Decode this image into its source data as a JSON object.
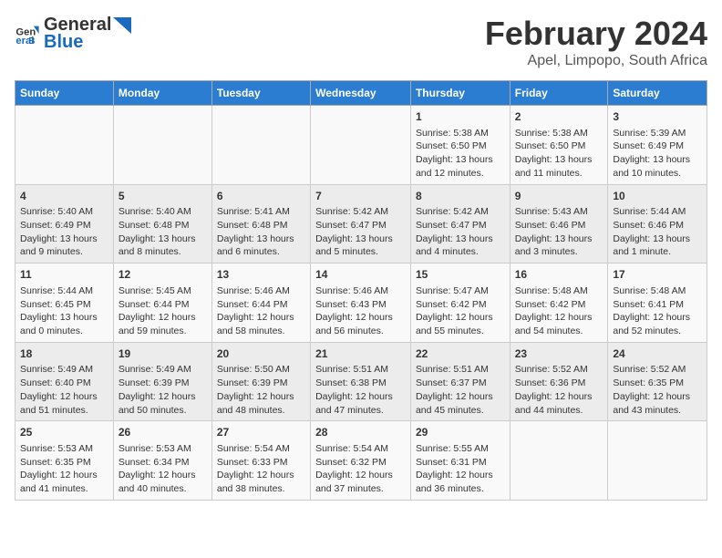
{
  "logo": {
    "line1": "General",
    "line2": "Blue"
  },
  "title": "February 2024",
  "subtitle": "Apel, Limpopo, South Africa",
  "days_of_week": [
    "Sunday",
    "Monday",
    "Tuesday",
    "Wednesday",
    "Thursday",
    "Friday",
    "Saturday"
  ],
  "weeks": [
    [
      {
        "day": "",
        "info": ""
      },
      {
        "day": "",
        "info": ""
      },
      {
        "day": "",
        "info": ""
      },
      {
        "day": "",
        "info": ""
      },
      {
        "day": "1",
        "info": "Sunrise: 5:38 AM\nSunset: 6:50 PM\nDaylight: 13 hours and 12 minutes."
      },
      {
        "day": "2",
        "info": "Sunrise: 5:38 AM\nSunset: 6:50 PM\nDaylight: 13 hours and 11 minutes."
      },
      {
        "day": "3",
        "info": "Sunrise: 5:39 AM\nSunset: 6:49 PM\nDaylight: 13 hours and 10 minutes."
      }
    ],
    [
      {
        "day": "4",
        "info": "Sunrise: 5:40 AM\nSunset: 6:49 PM\nDaylight: 13 hours and 9 minutes."
      },
      {
        "day": "5",
        "info": "Sunrise: 5:40 AM\nSunset: 6:48 PM\nDaylight: 13 hours and 8 minutes."
      },
      {
        "day": "6",
        "info": "Sunrise: 5:41 AM\nSunset: 6:48 PM\nDaylight: 13 hours and 6 minutes."
      },
      {
        "day": "7",
        "info": "Sunrise: 5:42 AM\nSunset: 6:47 PM\nDaylight: 13 hours and 5 minutes."
      },
      {
        "day": "8",
        "info": "Sunrise: 5:42 AM\nSunset: 6:47 PM\nDaylight: 13 hours and 4 minutes."
      },
      {
        "day": "9",
        "info": "Sunrise: 5:43 AM\nSunset: 6:46 PM\nDaylight: 13 hours and 3 minutes."
      },
      {
        "day": "10",
        "info": "Sunrise: 5:44 AM\nSunset: 6:46 PM\nDaylight: 13 hours and 1 minute."
      }
    ],
    [
      {
        "day": "11",
        "info": "Sunrise: 5:44 AM\nSunset: 6:45 PM\nDaylight: 13 hours and 0 minutes."
      },
      {
        "day": "12",
        "info": "Sunrise: 5:45 AM\nSunset: 6:44 PM\nDaylight: 12 hours and 59 minutes."
      },
      {
        "day": "13",
        "info": "Sunrise: 5:46 AM\nSunset: 6:44 PM\nDaylight: 12 hours and 58 minutes."
      },
      {
        "day": "14",
        "info": "Sunrise: 5:46 AM\nSunset: 6:43 PM\nDaylight: 12 hours and 56 minutes."
      },
      {
        "day": "15",
        "info": "Sunrise: 5:47 AM\nSunset: 6:42 PM\nDaylight: 12 hours and 55 minutes."
      },
      {
        "day": "16",
        "info": "Sunrise: 5:48 AM\nSunset: 6:42 PM\nDaylight: 12 hours and 54 minutes."
      },
      {
        "day": "17",
        "info": "Sunrise: 5:48 AM\nSunset: 6:41 PM\nDaylight: 12 hours and 52 minutes."
      }
    ],
    [
      {
        "day": "18",
        "info": "Sunrise: 5:49 AM\nSunset: 6:40 PM\nDaylight: 12 hours and 51 minutes."
      },
      {
        "day": "19",
        "info": "Sunrise: 5:49 AM\nSunset: 6:39 PM\nDaylight: 12 hours and 50 minutes."
      },
      {
        "day": "20",
        "info": "Sunrise: 5:50 AM\nSunset: 6:39 PM\nDaylight: 12 hours and 48 minutes."
      },
      {
        "day": "21",
        "info": "Sunrise: 5:51 AM\nSunset: 6:38 PM\nDaylight: 12 hours and 47 minutes."
      },
      {
        "day": "22",
        "info": "Sunrise: 5:51 AM\nSunset: 6:37 PM\nDaylight: 12 hours and 45 minutes."
      },
      {
        "day": "23",
        "info": "Sunrise: 5:52 AM\nSunset: 6:36 PM\nDaylight: 12 hours and 44 minutes."
      },
      {
        "day": "24",
        "info": "Sunrise: 5:52 AM\nSunset: 6:35 PM\nDaylight: 12 hours and 43 minutes."
      }
    ],
    [
      {
        "day": "25",
        "info": "Sunrise: 5:53 AM\nSunset: 6:35 PM\nDaylight: 12 hours and 41 minutes."
      },
      {
        "day": "26",
        "info": "Sunrise: 5:53 AM\nSunset: 6:34 PM\nDaylight: 12 hours and 40 minutes."
      },
      {
        "day": "27",
        "info": "Sunrise: 5:54 AM\nSunset: 6:33 PM\nDaylight: 12 hours and 38 minutes."
      },
      {
        "day": "28",
        "info": "Sunrise: 5:54 AM\nSunset: 6:32 PM\nDaylight: 12 hours and 37 minutes."
      },
      {
        "day": "29",
        "info": "Sunrise: 5:55 AM\nSunset: 6:31 PM\nDaylight: 12 hours and 36 minutes."
      },
      {
        "day": "",
        "info": ""
      },
      {
        "day": "",
        "info": ""
      }
    ]
  ]
}
